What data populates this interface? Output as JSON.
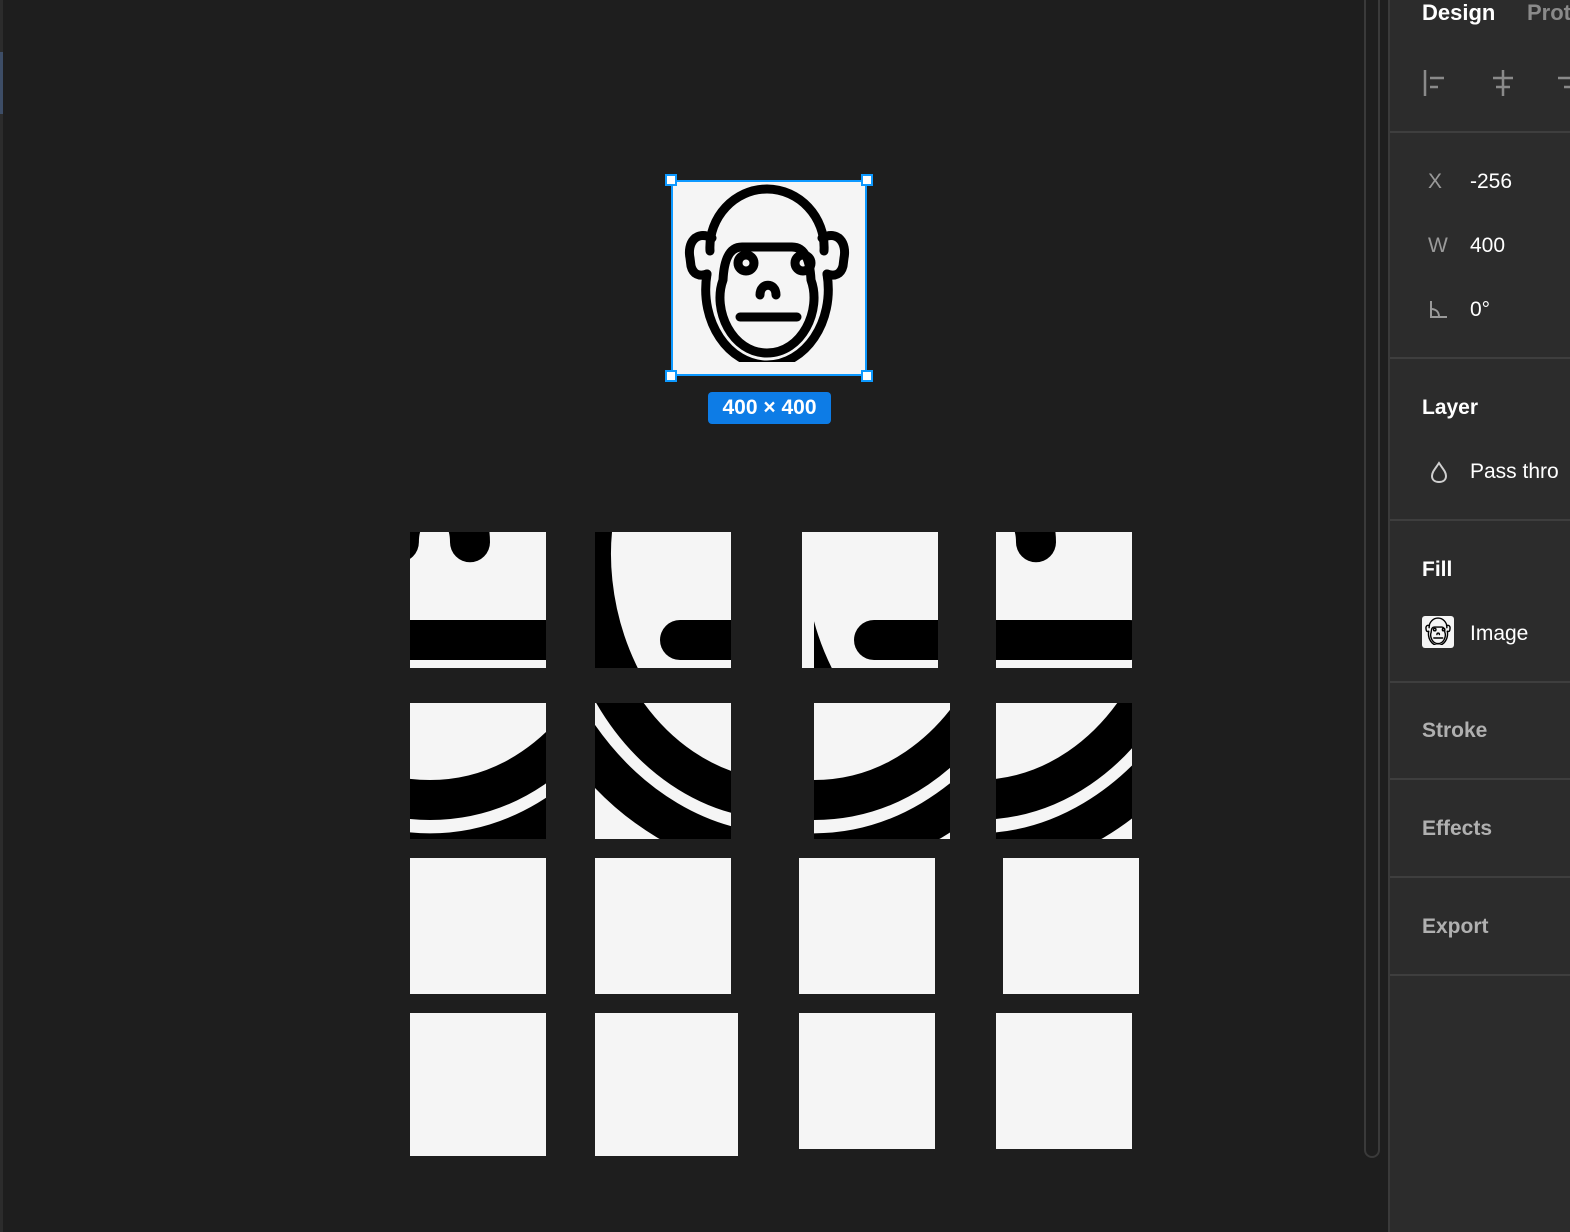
{
  "canvas": {
    "selection_size_label": "400 × 400",
    "selected_image_icon": "gorilla-face-icon"
  },
  "panel": {
    "tabs": [
      {
        "label": "Design"
      },
      {
        "label": "Prot"
      }
    ],
    "align_icons": [
      "align-left-icon",
      "align-horizontal-center-icon",
      "align-right-icon"
    ],
    "position": {
      "x_label": "X",
      "x_value": "-256",
      "w_label": "W",
      "w_value": "400",
      "rotation_icon": "rotation-angle-icon",
      "rotation_value": "0°"
    },
    "layer": {
      "title": "Layer",
      "blend_icon": "blend-mode-drop-icon",
      "blend_value": "Pass thro"
    },
    "fill": {
      "title": "Fill",
      "swatch_icon": "gorilla-face-icon",
      "type_label": "Image"
    },
    "stroke": {
      "title": "Stroke"
    },
    "effects": {
      "title": "Effects"
    },
    "export": {
      "title": "Export"
    }
  },
  "colors": {
    "canvas_bg": "#1e1e1e",
    "panel_bg": "#2c2c2c",
    "selection_accent": "#0d99ff",
    "badge_bg": "#0d7ce6",
    "tile_bg": "#f5f5f5"
  }
}
